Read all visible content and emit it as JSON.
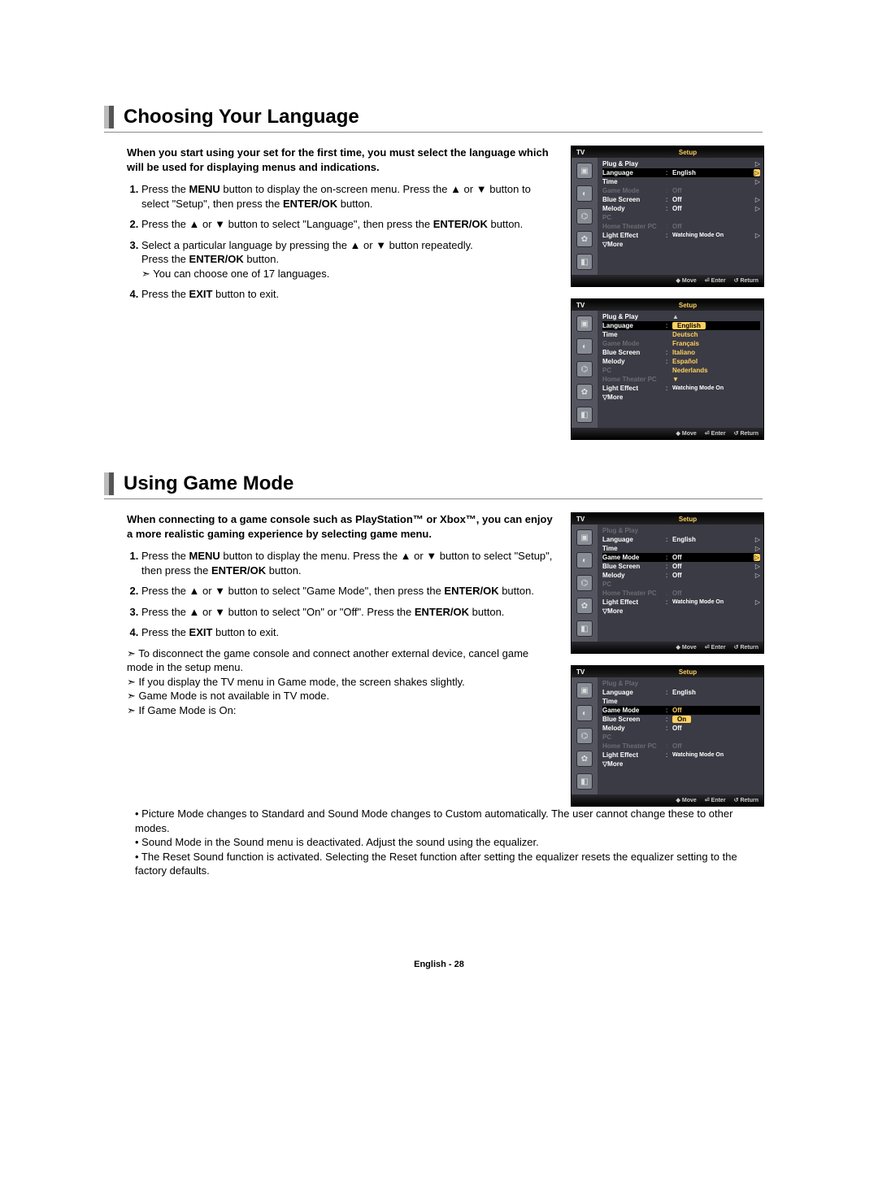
{
  "section1": {
    "title": "Choosing Your Language",
    "intro": "When you start using your set for the first time, you must select the language which will be used for displaying menus and indications.",
    "step1a": "Press the ",
    "step1b": "MENU",
    "step1c": " button to display the on-screen menu. Press the ▲ or ▼ button to select \"Setup\", then press the ",
    "step1d": "ENTER/OK",
    "step1e": " button.",
    "step2a": "Press the ▲ or ▼ button to select \"Language\", then press the ",
    "step2b": "ENTER/OK",
    "step2c": " button.",
    "step3a": "Select a particular language by pressing the ▲ or ▼ button repeatedly.",
    "step3b": "Press the ",
    "step3c": "ENTER/OK",
    "step3d": " button.",
    "step3_note": "You can choose one of 17 languages.",
    "step4a": "Press the ",
    "step4b": "EXIT",
    "step4c": " button to exit."
  },
  "section2": {
    "title": "Using Game Mode",
    "intro": "When connecting to a game console such as PlayStation™ or Xbox™, you can enjoy a more realistic gaming experience by selecting game menu.",
    "step1a": "Press the ",
    "step1b": "MENU",
    "step1c": " button to display the menu. Press the ▲ or ▼ button to select \"Setup\", then press the ",
    "step1d": "ENTER/OK",
    "step1e": " button.",
    "step2a": "Press the ▲ or ▼ button to select \"Game Mode\", then press the ",
    "step2b": "ENTER/OK",
    "step2c": " button.",
    "step3a": "Press the ▲ or ▼ button to select \"On\" or \"Off\". Press the ",
    "step3b": "ENTER/OK",
    "step3c": " button.",
    "step4a": "Press the ",
    "step4b": "EXIT",
    "step4c": " button to exit.",
    "note1": "To disconnect the game console and connect another external device, cancel game mode in the setup menu.",
    "note2": "If you display the TV menu in Game mode, the screen shakes slightly.",
    "note3": "Game Mode is not available in TV mode.",
    "note4": "If Game Mode is On:",
    "bullet1": "• Picture Mode changes to Standard and Sound Mode changes to Custom automatically. The user cannot change these to other modes.",
    "bullet2": "• Sound Mode in the Sound menu is deactivated. Adjust the sound using the equalizer.",
    "bullet3": "• The Reset Sound function is activated. Selecting the Reset function after setting the equalizer resets the equalizer setting to the factory defaults."
  },
  "osd_common": {
    "tv": "TV",
    "setup": "Setup",
    "plug_play": "Plug & Play",
    "language": "Language",
    "time": "Time",
    "game_mode": "Game Mode",
    "blue_screen": "Blue Screen",
    "melody": "Melody",
    "pc": "PC",
    "home_theater": "Home Theater PC",
    "light_effect": "Light Effect",
    "more": "▽More",
    "english": "English",
    "off": "Off",
    "on": "On",
    "watching": "Watching Mode On",
    "move": "Move",
    "enter": "Enter",
    "return": "Return",
    "tri": "▷"
  },
  "lang_options": {
    "english": "English",
    "deutsch": "Deutsch",
    "francais": "Français",
    "italiano": "Italiano",
    "espanol": "Español",
    "nederlands": "Nederlands"
  },
  "footer": "English - 28"
}
